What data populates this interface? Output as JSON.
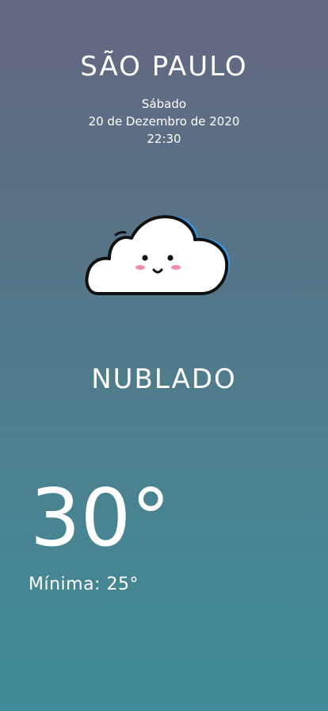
{
  "location": {
    "city": "SÃO PAULO",
    "weekday": "Sábado",
    "date": "20 de Dezembro de 2020",
    "time": "22:30"
  },
  "weather": {
    "icon": "cloud-icon",
    "condition": "NUBLADO",
    "temperature": "30°",
    "min_label": "Mínima:",
    "min_value": "25°"
  },
  "colors": {
    "background_top": "#646780",
    "background_bottom": "#3f8b97",
    "cloud_fill": "#ffffff",
    "cloud_accent": "#2f9cf0",
    "blush": "#f28bb0"
  }
}
